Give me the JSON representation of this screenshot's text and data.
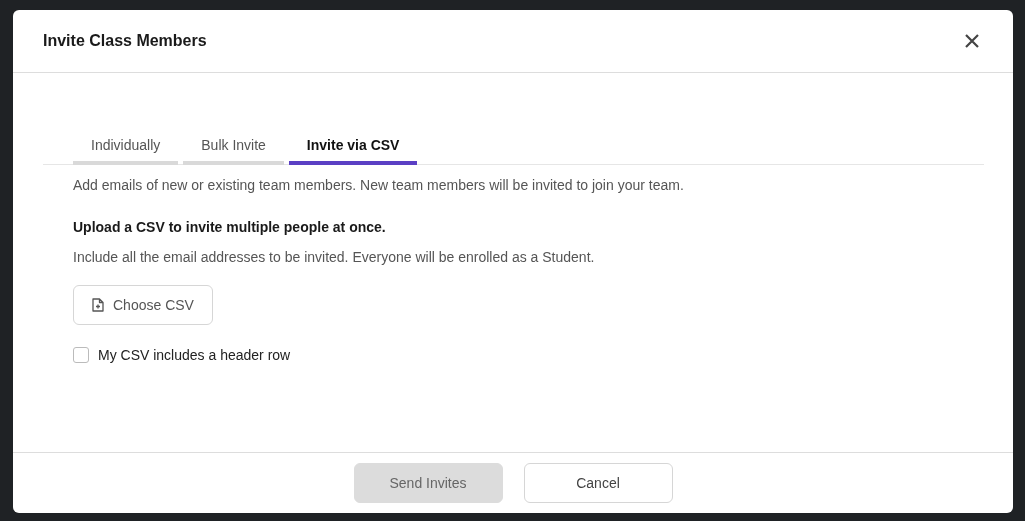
{
  "dialog": {
    "title": "Invite Class Members"
  },
  "tabs": [
    {
      "label": "Individually",
      "selected": false
    },
    {
      "label": "Bulk Invite",
      "selected": false
    },
    {
      "label": "Invite via CSV",
      "selected": true
    }
  ],
  "description": "Add emails of new or existing team members. New team members will be invited to join your team.",
  "upload": {
    "heading": "Upload a CSV to invite multiple people at once.",
    "hint": "Include all the email addresses to be invited. Everyone will be enrolled as a Student.",
    "button": "Choose CSV"
  },
  "header_row_checkbox": {
    "label": "My CSV includes a header row",
    "checked": false
  },
  "buttons": [
    {
      "label": "Send Invites",
      "disabled": true
    },
    {
      "label": "Cancel",
      "disabled": false
    }
  ]
}
